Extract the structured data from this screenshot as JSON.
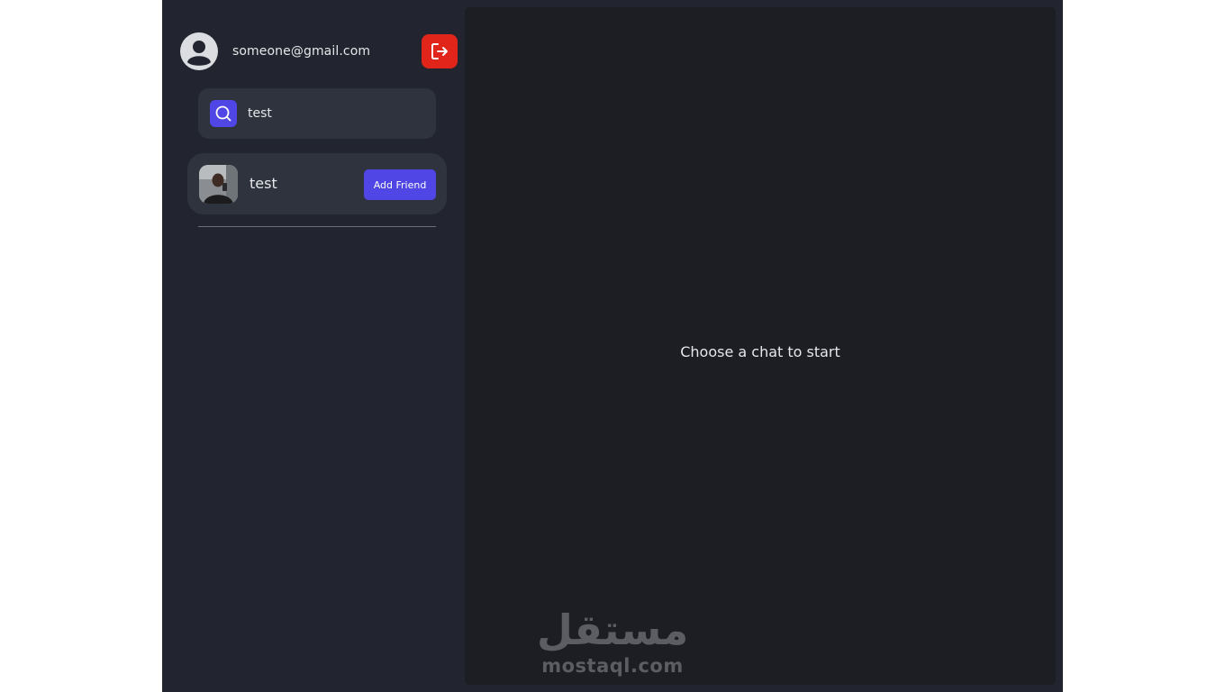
{
  "user": {
    "email": "someone@gmail.com",
    "avatar_icon": "user-avatar-icon",
    "logout_icon": "logout-icon"
  },
  "search": {
    "value": "test",
    "icon": "search-icon"
  },
  "results": [
    {
      "name": "test",
      "action_label": "Add Friend"
    }
  ],
  "chat": {
    "empty_message": "Choose a chat to start"
  },
  "watermark": {
    "arabic": "مستقل",
    "latin": "mostaql.com"
  },
  "colors": {
    "app_background": "#22252f",
    "panel_background": "#1d1e23",
    "card_background": "#2f333e",
    "accent": "#4f46e5",
    "logout": "#e1251b"
  }
}
